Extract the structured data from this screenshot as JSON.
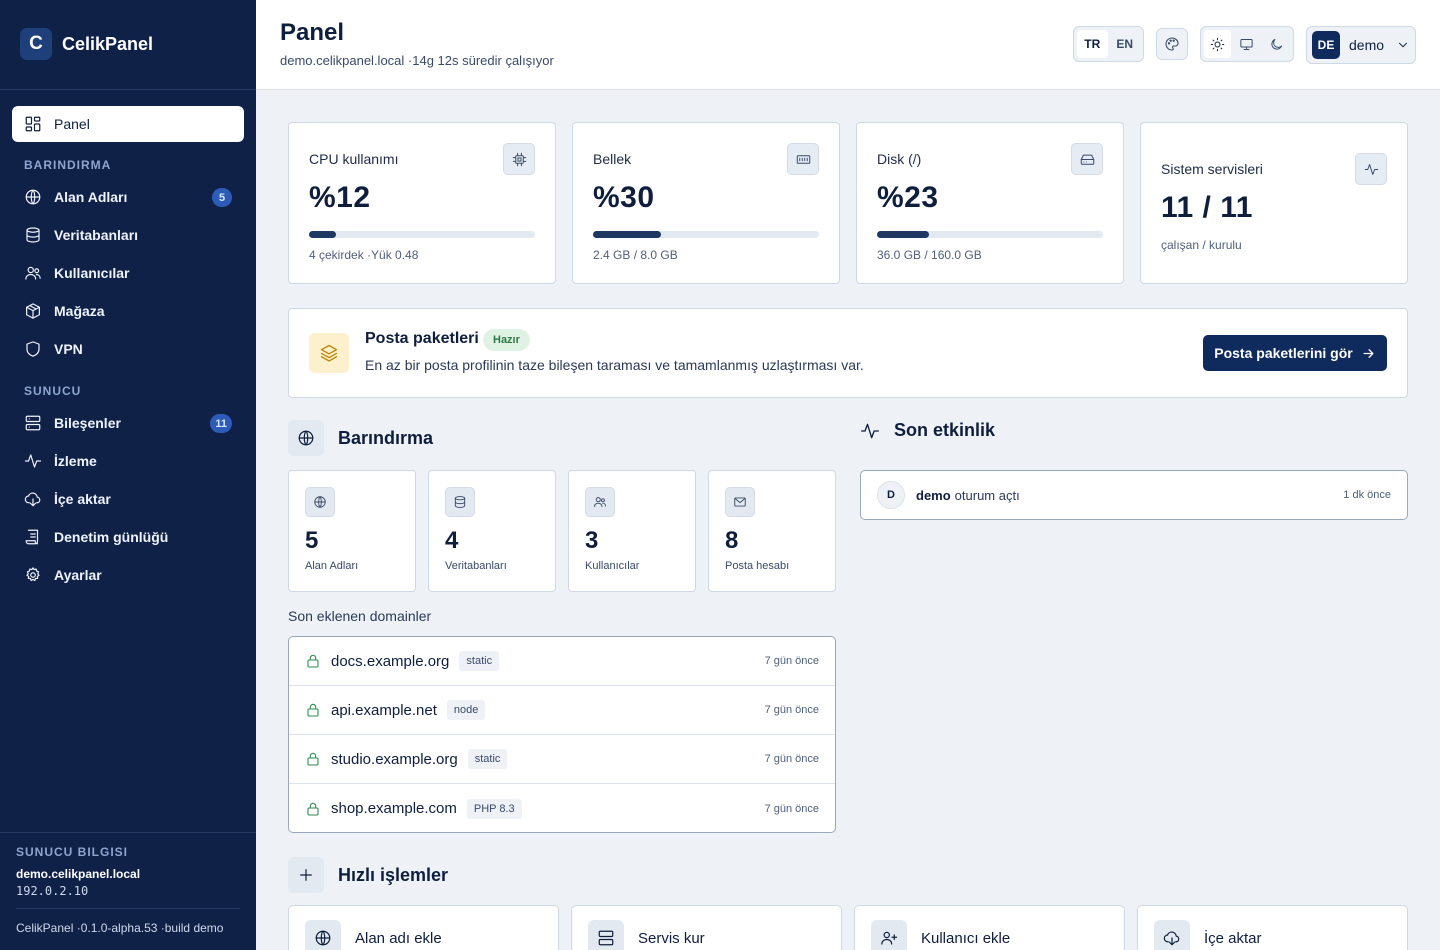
{
  "sidebar": {
    "brand": "CelikPanel",
    "logo_letter": "C",
    "active_item": "Panel",
    "section_hosting": "BARINDIRMA",
    "hosting_items": [
      {
        "label": "Alan Adları",
        "badge": "5"
      },
      {
        "label": "Veritabanları"
      },
      {
        "label": "Kullanıcılar"
      },
      {
        "label": "Mağaza"
      },
      {
        "label": "VPN"
      }
    ],
    "section_server": "SUNUCU",
    "server_items": [
      {
        "label": "Bileşenler",
        "badge": "11"
      },
      {
        "label": "İzleme"
      },
      {
        "label": "İçe aktar"
      },
      {
        "label": "Denetim günlüğü"
      },
      {
        "label": "Ayarlar"
      }
    ],
    "server_info_title": "SUNUCU BILGISI",
    "server_host": "demo.celikpanel.local",
    "server_ip": "192.0.2.10",
    "version_text": "CelikPanel ·0.1.0-alpha.53 ·build demo"
  },
  "header": {
    "title": "Panel",
    "subtitle": "demo.celikpanel.local ·14g 12s süredir çalışıyor",
    "languages": [
      "TR",
      "EN"
    ],
    "active_language": "TR",
    "user_initials": "DE",
    "user_name": "demo"
  },
  "stats": [
    {
      "label": "CPU kullanımı",
      "value": "%12",
      "meta": "4 çekirdek ·Yük 0.48",
      "progress": 12,
      "icon": "cpu-icon"
    },
    {
      "label": "Bellek",
      "value": "%30",
      "meta": "2.4 GB / 8.0 GB",
      "progress": 30,
      "icon": "memory-icon"
    },
    {
      "label": "Disk (/)",
      "value": "%23",
      "meta": "36.0 GB / 160.0 GB",
      "progress": 23,
      "icon": "disk-icon"
    },
    {
      "label": "Sistem servisleri",
      "value": "11 / 11",
      "meta": "çalışan / kurulu",
      "icon": "activity-icon"
    }
  ],
  "mail": {
    "title": "Posta paketleri",
    "badge": "Hazır",
    "description": "En az bir posta profilinin taze bileşen taraması ve tamamlanmış uzlaştırması var.",
    "button": "Posta paketlerini gör"
  },
  "hosting": {
    "title": "Barındırma",
    "cards": [
      {
        "value": "5",
        "label": "Alan Adları",
        "icon": "globe-icon"
      },
      {
        "value": "4",
        "label": "Veritabanları",
        "icon": "database-icon"
      },
      {
        "value": "3",
        "label": "Kullanıcılar",
        "icon": "users-icon"
      },
      {
        "value": "8",
        "label": "Posta hesabı",
        "icon": "mail-icon"
      }
    ],
    "recent_title": "Son eklenen domainler",
    "domains": [
      {
        "name": "docs.example.org",
        "tag": "static",
        "time": "7 gün önce"
      },
      {
        "name": "api.example.net",
        "tag": "node",
        "time": "7 gün önce"
      },
      {
        "name": "studio.example.org",
        "tag": "static",
        "time": "7 gün önce"
      },
      {
        "name": "shop.example.com",
        "tag": "PHP 8.3",
        "time": "7 gün önce"
      }
    ]
  },
  "activity": {
    "title": "Son etkinlik",
    "items": [
      {
        "initial": "D",
        "user": "demo",
        "text": "oturum açtı",
        "time": "1 dk önce"
      }
    ]
  },
  "quick_actions": {
    "title": "Hızlı işlemler",
    "items": [
      {
        "label": "Alan adı ekle"
      },
      {
        "label": "Servis kur"
      },
      {
        "label": "Kullanıcı ekle"
      },
      {
        "label": "İçe aktar"
      }
    ]
  }
}
